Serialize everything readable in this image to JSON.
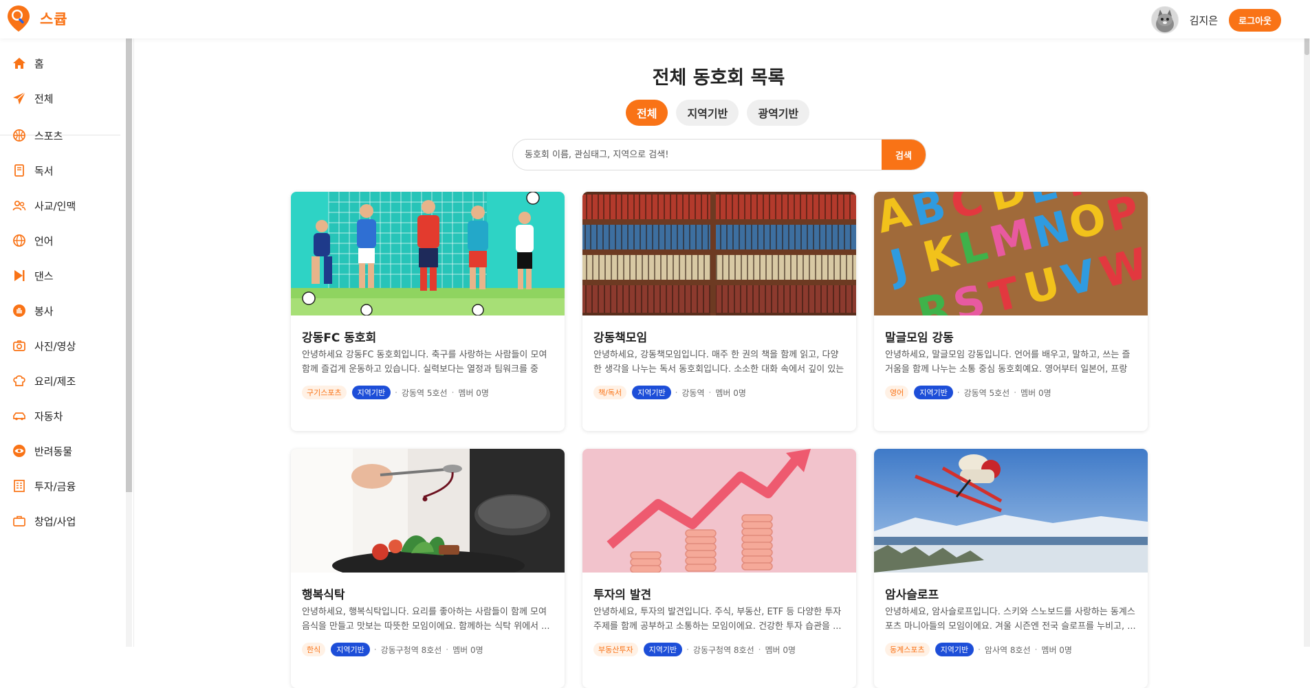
{
  "app": {
    "name": "스큡",
    "brand_color": "#f97316"
  },
  "user": {
    "name": "김지은",
    "logout_label": "로그아웃"
  },
  "sidebar": {
    "primary": [
      {
        "label": "홈",
        "icon": "home-icon"
      },
      {
        "label": "전체",
        "icon": "send-icon"
      }
    ],
    "categories": [
      {
        "label": "스포츠",
        "icon": "ball-icon"
      },
      {
        "label": "독서",
        "icon": "book-icon"
      },
      {
        "label": "사교/인맥",
        "icon": "people-icon"
      },
      {
        "label": "언어",
        "icon": "globe-icon"
      },
      {
        "label": "댄스",
        "icon": "play-icon"
      },
      {
        "label": "봉사",
        "icon": "hand-icon"
      },
      {
        "label": "사진/영상",
        "icon": "camera-icon"
      },
      {
        "label": "요리/제조",
        "icon": "chef-hat-icon"
      },
      {
        "label": "자동차",
        "icon": "car-icon"
      },
      {
        "label": "반려동물",
        "icon": "eye-icon"
      },
      {
        "label": "투자/금융",
        "icon": "building-icon"
      },
      {
        "label": "창업/사업",
        "icon": "briefcase-icon"
      }
    ]
  },
  "main": {
    "title": "전체 동호회 목록",
    "tabs": [
      {
        "label": "전체",
        "active": true
      },
      {
        "label": "지역기반",
        "active": false
      },
      {
        "label": "광역기반",
        "active": false
      }
    ],
    "search": {
      "placeholder": "동호회 이름, 관심태그, 지역으로 검색!",
      "button": "검색"
    }
  },
  "clubs": [
    {
      "name": "강동FC 동호회",
      "desc": "안녕하세요 강동FC 동호회입니다. 축구를 사랑하는 사람들이 모여 함께 즐겁게 운동하고 있습니다. 실력보다는 열정과 팀워크를 중요...",
      "category": "구기스포츠",
      "type": "지역기반",
      "location": "강동역 5호선",
      "members": "멤버 0명",
      "image": "soccer-players"
    },
    {
      "name": "강동책모임",
      "desc": "안녕하세요, 강동책모임입니다. 매주 한 권의 책을 함께 읽고, 다양한 생각을 나누는 독서 동호회입니다. 소소한 대화 속에서 깊이 있는 ...",
      "category": "책/독서",
      "type": "지역기반",
      "location": "강동역",
      "members": "멤버 0명",
      "image": "bookshelf"
    },
    {
      "name": "말글모임 강동",
      "desc": "안녕하세요, 말글모임 강동입니다. 언어를 배우고, 말하고, 쓰는 즐거움을 함께 나누는 소통 중심 동호회예요. 영어부터 일본어, 프랑스...",
      "category": "영어",
      "type": "지역기반",
      "location": "강동역 5호선",
      "members": "멤버 0명",
      "image": "alphabet-letters"
    },
    {
      "name": "행복식탁",
      "desc": "안녕하세요, 행복식탁입니다. 요리를 좋아하는 사람들이 함께 모여 음식을 만들고 맛보는 따뜻한 모임이에요. 함께하는 식탁 위에서 ...",
      "category": "한식",
      "type": "지역기반",
      "location": "강동구청역 8호선",
      "members": "멤버 0명",
      "image": "chef-plating"
    },
    {
      "name": "투자의 발견",
      "desc": "안녕하세요, 투자의 발견입니다. 주식, 부동산, ETF 등 다양한 투자 주제를 함께 공부하고 소통하는 모임이에요. 건강한 투자 습관을 ...",
      "category": "부동산투자",
      "type": "지역기반",
      "location": "강동구청역 8호선",
      "members": "멤버 0명",
      "image": "rising-coins"
    },
    {
      "name": "암사슬로프",
      "desc": "안녕하세요, 암사슬로프입니다. 스키와 스노보드를 사랑하는 동계스포츠 마니아들의 모임이에요. 겨울 시즌엔 전국 슬로프를 누비고, ...",
      "category": "동계스포츠",
      "type": "지역기반",
      "location": "암사역 8호선",
      "members": "멤버 0명",
      "image": "skier-jump"
    }
  ]
}
